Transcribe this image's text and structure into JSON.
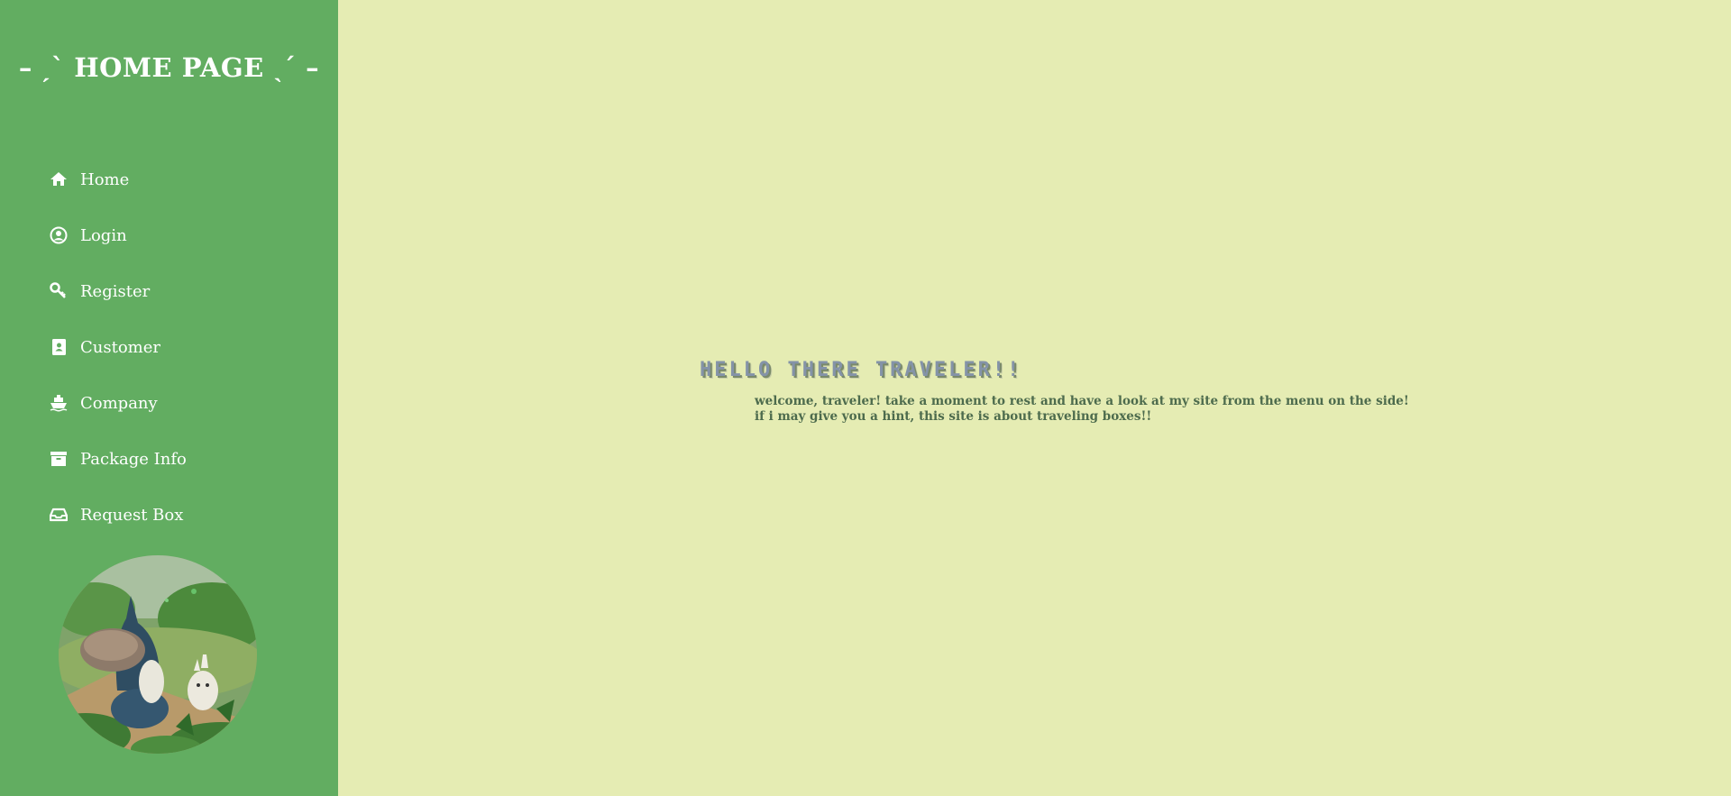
{
  "sidebar": {
    "title": "– ˏˋ HOME PAGE ˎˊ –",
    "items": [
      {
        "label": "Home",
        "icon": "home-icon"
      },
      {
        "label": "Login",
        "icon": "user-circle-icon"
      },
      {
        "label": "Register",
        "icon": "key-icon"
      },
      {
        "label": "Customer",
        "icon": "address-book-icon"
      },
      {
        "label": "Company",
        "icon": "ship-icon"
      },
      {
        "label": "Package Info",
        "icon": "archive-box-icon"
      },
      {
        "label": "Request Box",
        "icon": "inbox-icon"
      }
    ]
  },
  "main": {
    "heading": "HELLO THERE TRAVELER!!",
    "line1": "welcome, traveler! take a moment to rest and have a look at my site from the menu on the side!",
    "line2": "if i may give you a hint, this site is about traveling boxes!!"
  },
  "colors": {
    "sidebar_bg": "#62ad61",
    "main_bg": "#e5ecb3",
    "heading": "#8493a8",
    "body_text": "#4d6b4d"
  }
}
